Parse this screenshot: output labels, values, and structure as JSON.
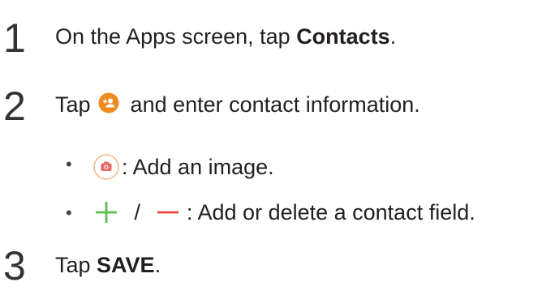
{
  "steps": [
    {
      "number": "1",
      "text_before": "On the Apps screen, tap ",
      "bold": "Contacts",
      "text_after": "."
    },
    {
      "number": "2",
      "text_before": "Tap ",
      "text_after": " and enter contact information.",
      "icon": "add-contact-icon",
      "bullets": [
        {
          "icon": "camera-icon",
          "text": ": Add an image."
        },
        {
          "icons": [
            "plus-icon",
            "minus-icon"
          ],
          "separator": " / ",
          "text": ": Add or delete a contact field."
        }
      ]
    },
    {
      "number": "3",
      "text_before": "Tap ",
      "bold": "SAVE",
      "text_after": "."
    }
  ],
  "colors": {
    "orange": "#f28a22",
    "green": "#5cbf4f",
    "red": "#e8473b"
  }
}
